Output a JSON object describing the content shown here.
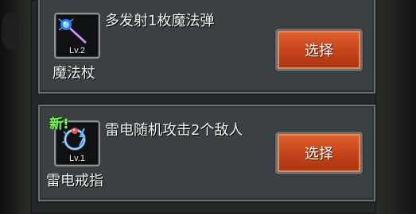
{
  "cards": [
    {
      "icon": "magic-wand-icon",
      "level": "Lv.2",
      "name": "魔法杖",
      "description": "多发射1枚魔法弹",
      "button": "选择",
      "is_new": false
    },
    {
      "icon": "thunder-ring-icon",
      "level": "Lv.1",
      "name": "雷电戒指",
      "description": "雷电随机攻击2个敌人",
      "button": "选择",
      "is_new": true,
      "new_label": "新!"
    }
  ],
  "colors": {
    "button": "#c4421a",
    "new_badge": "#7cf05a",
    "card_bg": "#3b4043"
  }
}
